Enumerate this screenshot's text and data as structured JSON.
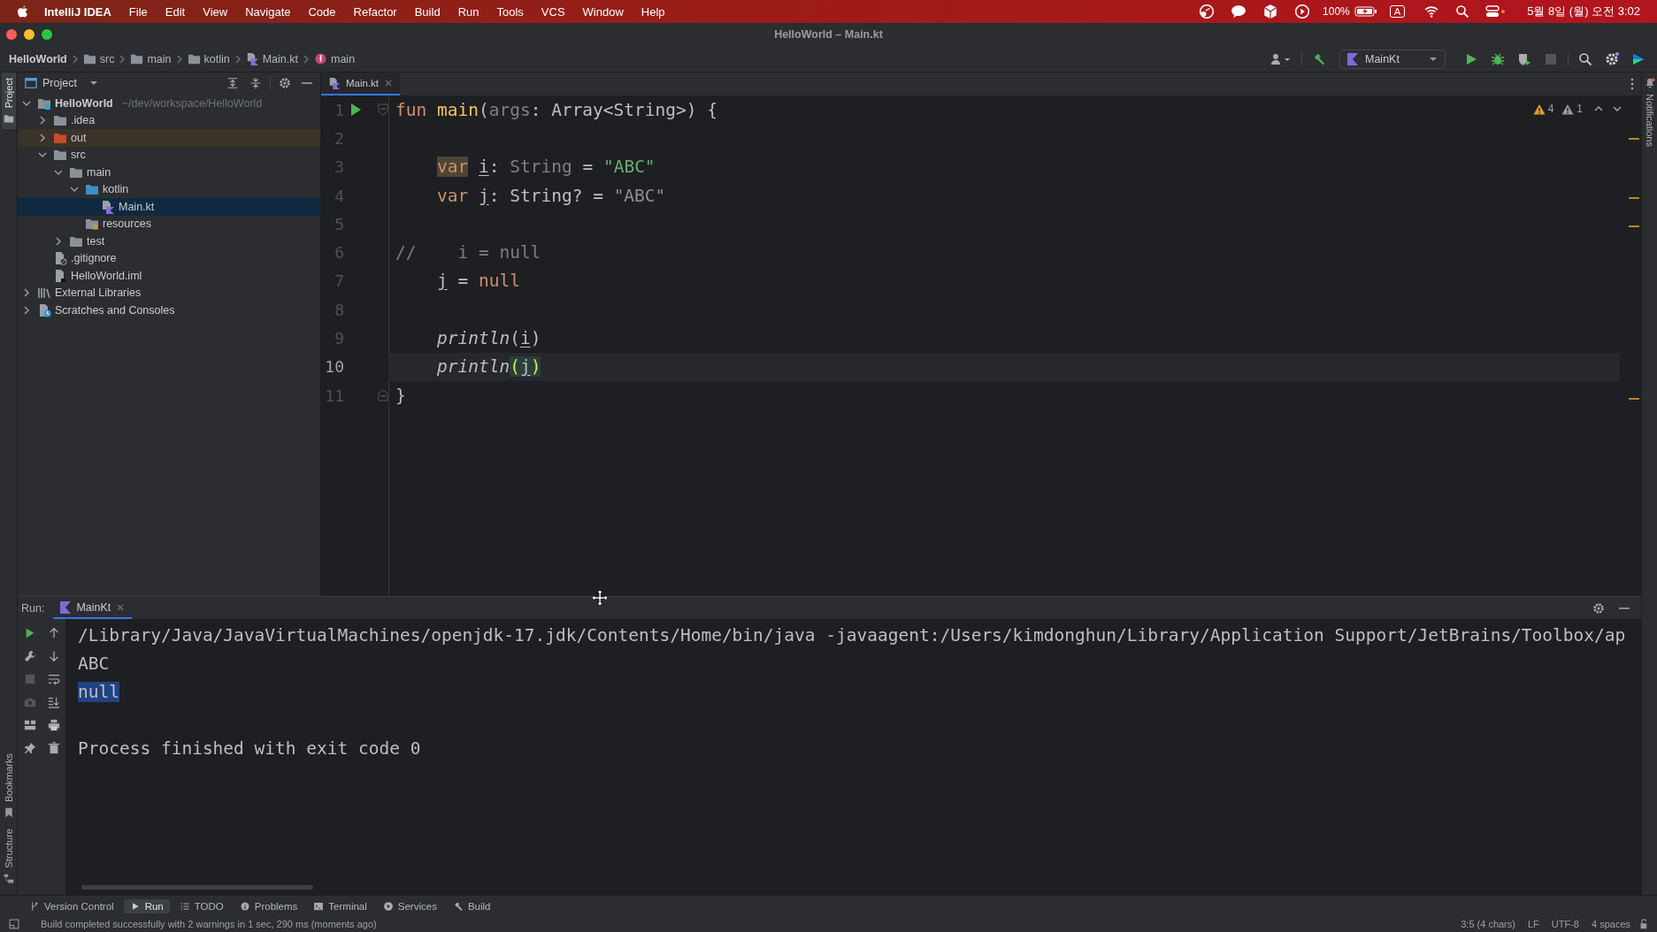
{
  "menubar": {
    "app": "IntelliJ IDEA",
    "menus": [
      "File",
      "Edit",
      "View",
      "Navigate",
      "Code",
      "Refactor",
      "Build",
      "Run",
      "Tools",
      "VCS",
      "Window",
      "Help"
    ],
    "battery": "100%",
    "input_source": "A",
    "clock": "5월 8일 (월) 오전 3:02"
  },
  "window": {
    "title": "HelloWorld – Main.kt"
  },
  "breadcrumbs": [
    {
      "label": "HelloWorld",
      "kind": "project"
    },
    {
      "label": "src",
      "kind": "folder"
    },
    {
      "label": "main",
      "kind": "folder"
    },
    {
      "label": "kotlin",
      "kind": "folder"
    },
    {
      "label": "Main.kt",
      "kind": "kotlin-file"
    },
    {
      "label": "main",
      "kind": "function"
    }
  ],
  "toolbar": {
    "run_config": "MainKt"
  },
  "tool_strips": {
    "left_top": [
      {
        "label": "Project",
        "selected": true
      }
    ],
    "left_bottom": [
      {
        "label": "Bookmarks",
        "selected": false
      },
      {
        "label": "Structure",
        "selected": false
      }
    ],
    "right": [
      {
        "label": "Notifications",
        "selected": false
      }
    ]
  },
  "project": {
    "title": "Project",
    "tree": [
      {
        "label": "HelloWorld",
        "path": "~/dev/workspace/HelloWorld",
        "kind": "module",
        "expanded": true,
        "selected": false,
        "children": [
          {
            "label": ".idea",
            "kind": "folder",
            "expanded": false,
            "selected": false
          },
          {
            "label": "out",
            "kind": "excluded-folder",
            "expanded": false,
            "selected": false
          },
          {
            "label": "src",
            "kind": "folder",
            "expanded": true,
            "selected": false,
            "children": [
              {
                "label": "main",
                "kind": "folder",
                "expanded": true,
                "selected": false,
                "children": [
                  {
                    "label": "kotlin",
                    "kind": "source-folder",
                    "expanded": true,
                    "selected": false,
                    "children": [
                      {
                        "label": "Main.kt",
                        "kind": "kotlin-file",
                        "selected": true
                      }
                    ]
                  },
                  {
                    "label": "resources",
                    "kind": "resources-folder",
                    "selected": false
                  }
                ]
              },
              {
                "label": "test",
                "kind": "folder",
                "expanded": false,
                "selected": false
              }
            ]
          },
          {
            "label": ".gitignore",
            "kind": "ignore-file",
            "selected": false
          },
          {
            "label": "HelloWorld.iml",
            "kind": "iml-file",
            "selected": false
          }
        ]
      },
      {
        "label": "External Libraries",
        "kind": "libraries",
        "expanded": false,
        "selected": false
      },
      {
        "label": "Scratches and Consoles",
        "kind": "scratches",
        "expanded": false,
        "selected": false
      }
    ]
  },
  "editor": {
    "tabs": [
      {
        "label": "Main.kt",
        "selected": true
      }
    ],
    "inspections": {
      "warnings": "4",
      "weak_warnings": "1"
    },
    "lines": [
      {
        "number": "1",
        "current": false,
        "run_icon": true,
        "fold_open": true,
        "fold_close": false,
        "indented": false,
        "tokens": [
          {
            "text": "fun",
            "kind": "kw"
          },
          {
            "text": " main",
            "kind": "decl"
          },
          {
            "text": "(",
            "kind": "plain"
          },
          {
            "text": "args",
            "kind": "unused"
          },
          {
            "text": ": Array<String>) {",
            "kind": "plain"
          }
        ]
      },
      {
        "number": "2",
        "current": false,
        "run_icon": false,
        "fold_open": false,
        "fold_close": false,
        "indented": false
      },
      {
        "number": "3",
        "current": false,
        "run_icon": false,
        "fold_open": false,
        "fold_close": false,
        "indented": true,
        "tokens": [
          {
            "text": "var",
            "kind": "kw-warn"
          },
          {
            "text": " i",
            "kind": "ref"
          },
          {
            "text": ": ",
            "kind": "plain"
          },
          {
            "text": "String",
            "kind": "dim"
          },
          {
            "text": " = ",
            "kind": "plain"
          },
          {
            "text": "\"ABC\"",
            "kind": "str"
          }
        ]
      },
      {
        "number": "4",
        "current": false,
        "run_icon": false,
        "fold_open": false,
        "fold_close": false,
        "indented": true,
        "tokens": [
          {
            "text": "var",
            "kind": "kw"
          },
          {
            "text": " j",
            "kind": "ref"
          },
          {
            "text": ": String? = ",
            "kind": "plain"
          },
          {
            "text": "\"ABC\"",
            "kind": "str-dim"
          }
        ]
      },
      {
        "number": "5",
        "current": false,
        "run_icon": false,
        "fold_open": false,
        "fold_close": false,
        "indented": false
      },
      {
        "number": "6",
        "current": false,
        "run_icon": false,
        "fold_open": false,
        "fold_close": false,
        "indented": false,
        "tokens": [
          {
            "text": "//    i = null",
            "kind": "comment"
          }
        ]
      },
      {
        "number": "7",
        "current": false,
        "run_icon": false,
        "fold_open": false,
        "fold_close": false,
        "indented": true,
        "tokens": [
          {
            "text": "j",
            "kind": "ref"
          },
          {
            "text": " = ",
            "kind": "plain"
          },
          {
            "text": "null",
            "kind": "kw"
          }
        ]
      },
      {
        "number": "8",
        "current": false,
        "run_icon": false,
        "fold_open": false,
        "fold_close": false,
        "indented": false
      },
      {
        "number": "9",
        "current": false,
        "run_icon": false,
        "fold_open": false,
        "fold_close": false,
        "indented": true,
        "tokens": [
          {
            "text": "println",
            "kind": "call"
          },
          {
            "text": "(",
            "kind": "plain"
          },
          {
            "text": "i",
            "kind": "ref"
          },
          {
            "text": ")",
            "kind": "plain"
          }
        ]
      },
      {
        "number": "10",
        "current": true,
        "run_icon": false,
        "fold_open": false,
        "fold_close": false,
        "indented": true,
        "tokens": [
          {
            "text": "println",
            "kind": "call"
          },
          {
            "text": "(",
            "kind": "match"
          },
          {
            "text": "j",
            "kind": "ref-match"
          },
          {
            "text": ")",
            "kind": "match"
          }
        ]
      },
      {
        "number": "11",
        "current": false,
        "run_icon": false,
        "fold_open": false,
        "fold_close": true,
        "indented": false,
        "tokens": [
          {
            "text": "}",
            "kind": "plain"
          }
        ]
      }
    ]
  },
  "run": {
    "label": "Run:",
    "tabs": [
      {
        "label": "MainKt",
        "selected": true
      }
    ],
    "output": [
      {
        "text": "/Library/Java/JavaVirtualMachines/openjdk-17.jdk/Contents/Home/bin/java -javaagent:/Users/kimdonghun/Library/Application Support/JetBrains/Toolbox/ap",
        "kind": "plain"
      },
      {
        "text": "ABC",
        "kind": "plain"
      },
      {
        "text": "null",
        "kind": "selected"
      },
      {
        "text": "Process finished with exit code 0",
        "kind": "exit"
      }
    ]
  },
  "tool_windows": [
    {
      "label": "Version Control",
      "kind": "vcs",
      "selected": false
    },
    {
      "label": "Run",
      "kind": "run",
      "selected": true
    },
    {
      "label": "TODO",
      "kind": "todo",
      "selected": false
    },
    {
      "label": "Problems",
      "kind": "problems",
      "selected": false
    },
    {
      "label": "Terminal",
      "kind": "terminal",
      "selected": false
    },
    {
      "label": "Services",
      "kind": "services",
      "selected": false
    },
    {
      "label": "Build",
      "kind": "build",
      "selected": false
    }
  ],
  "status_bar": {
    "message": "Build completed successfully with 2 warnings in 1 sec, 290 ms (moments ago)",
    "items": [
      "3:5 (4 chars)",
      "LF",
      "UTF-8",
      "4 spaces"
    ]
  }
}
